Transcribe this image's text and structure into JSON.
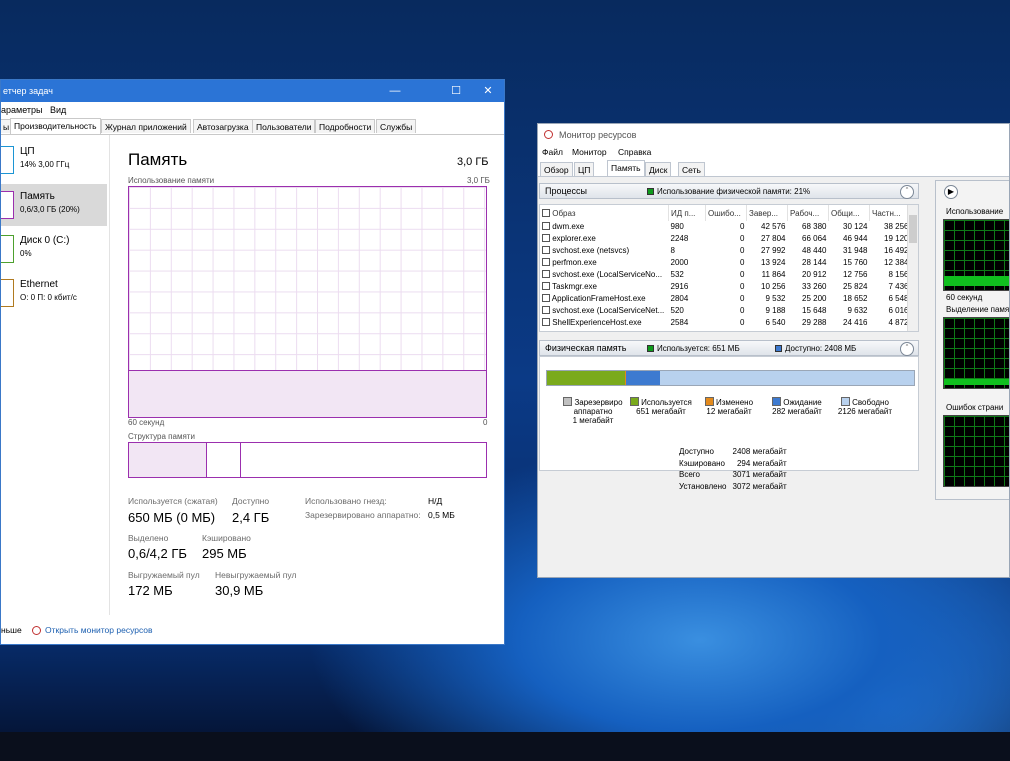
{
  "taskmgr": {
    "title": "етчер задач",
    "menu": [
      "араметры",
      "Вид"
    ],
    "tabs": [
      "ы",
      "Производительность",
      "Журнал приложений",
      "Автозагрузка",
      "Пользователи",
      "Подробности",
      "Службы"
    ],
    "sidebar": [
      {
        "name": "ЦП",
        "sub": "14% 3,00 ГГц"
      },
      {
        "name": "Память",
        "sub": "0,6/3,0 ГБ (20%)"
      },
      {
        "name": "Диск 0 (C:)",
        "sub": "0%"
      },
      {
        "name": "Ethernet",
        "sub": "О: 0 П: 0 кбит/с"
      }
    ],
    "main": {
      "title": "Память",
      "total": "3,0 ГБ",
      "usage_label": "Использование памяти",
      "usage_max": "3,0 ГБ",
      "time_left": "60 секунд",
      "time_right": "0",
      "structure_label": "Структура памяти",
      "usage_fraction": 0.2
    },
    "stats": {
      "used_label": "Используется (сжатая)",
      "used_value": "650 МБ (0 МБ)",
      "avail_label": "Доступно",
      "avail_value": "2,4 ГБ",
      "committed_label": "Выделено",
      "committed_value": "0,6/4,2 ГБ",
      "cached_label": "Кэшировано",
      "cached_value": "295 МБ",
      "paged_label": "Выгружаемый пул",
      "paged_value": "172 МБ",
      "nonpaged_label": "Невыгружаемый пул",
      "nonpaged_value": "30,9 МБ",
      "slots_label": "Использовано гнезд:",
      "slots_value": "Н/Д",
      "hwres_label": "Зарезервировано аппаратно:",
      "hwres_value": "0,5 МБ"
    },
    "footer": {
      "less": "ньше",
      "link": "Открыть монитор ресурсов"
    }
  },
  "resmon": {
    "title": "Монитор ресурсов",
    "menu": [
      "Файл",
      "Монитор",
      "Справка"
    ],
    "tabs": [
      "Обзор",
      "ЦП",
      "Память",
      "Диск",
      "Сеть"
    ],
    "processes": {
      "header": "Процессы",
      "legend": "Использование физической памяти: 21%",
      "columns": [
        "Образ",
        "ИД п...",
        "Ошибо...",
        "Завер...",
        "Рабоч...",
        "Общи...",
        "Частн..."
      ],
      "rows": [
        [
          "dwm.exe",
          "980",
          "0",
          "42 576",
          "68 380",
          "30 124",
          "38 256"
        ],
        [
          "explorer.exe",
          "2248",
          "0",
          "27 804",
          "66 064",
          "46 944",
          "19 120"
        ],
        [
          "svchost.exe (netsvcs)",
          "8",
          "0",
          "27 992",
          "48 440",
          "31 948",
          "16 492"
        ],
        [
          "perfmon.exe",
          "2000",
          "0",
          "13 924",
          "28 144",
          "15 760",
          "12 384"
        ],
        [
          "svchost.exe (LocalServiceNo...",
          "532",
          "0",
          "11 864",
          "20 912",
          "12 756",
          "8 156"
        ],
        [
          "Taskmgr.exe",
          "2916",
          "0",
          "10 256",
          "33 260",
          "25 824",
          "7 436"
        ],
        [
          "ApplicationFrameHost.exe",
          "2804",
          "0",
          "9 532",
          "25 200",
          "18 652",
          "6 548"
        ],
        [
          "svchost.exe (LocalServiceNet...",
          "520",
          "0",
          "9 188",
          "15 648",
          "9 632",
          "6 016"
        ],
        [
          "ShellExperienceHost.exe",
          "2584",
          "0",
          "6 540",
          "29 288",
          "24 416",
          "4 872"
        ]
      ]
    },
    "physical": {
      "header": "Физическая память",
      "legend_used": "Используется: 651 МБ",
      "legend_avail": "Доступно: 2408 МБ",
      "bar": {
        "reserved": 1,
        "used": 651,
        "modified": 12,
        "standby": 282,
        "free": 2126,
        "total": 3072
      },
      "categories": [
        {
          "label": "Зарезервиро аппаратно",
          "value": "1 мегабайт",
          "color": "#c0c0c0"
        },
        {
          "label": "Используется",
          "value": "651 мегабайт",
          "color": "#7aaa1c"
        },
        {
          "label": "Изменено",
          "value": "12 мегабайт",
          "color": "#e38a1c"
        },
        {
          "label": "Ожидание",
          "value": "282 мегабайт",
          "color": "#3d7ad0"
        },
        {
          "label": "Свободно",
          "value": "2126 мегабайт",
          "color": "#b8d1ee"
        }
      ],
      "summary": [
        [
          "Доступно",
          "2408 мегабайт"
        ],
        [
          "Кэшировано",
          "294 мегабайт"
        ],
        [
          "Всего",
          "3071 мегабайт"
        ],
        [
          "Установлено",
          "3072 мегабайт"
        ]
      ]
    },
    "right": {
      "label1": "Использование",
      "time": "60 секунд",
      "label2": "Выделение памя",
      "label3": "Ошибок страни"
    }
  }
}
